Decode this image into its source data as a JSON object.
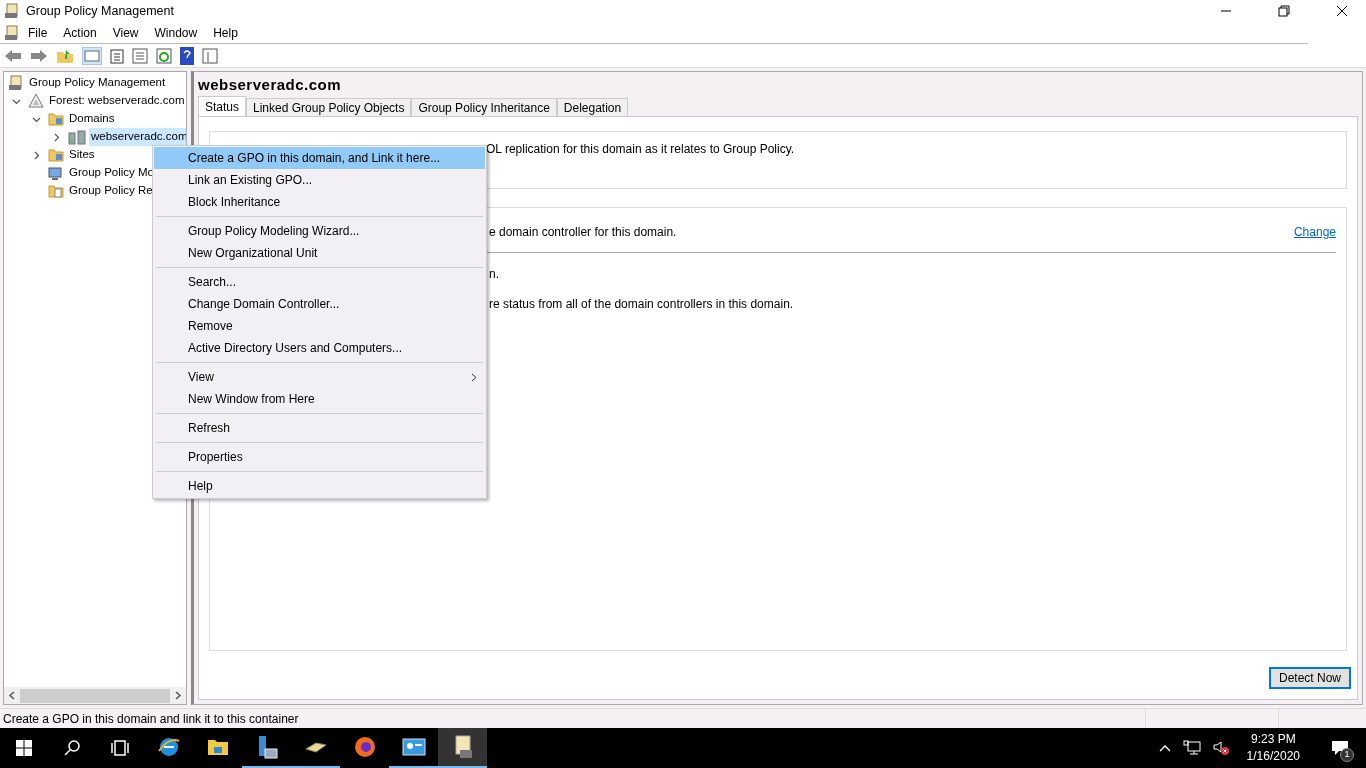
{
  "window": {
    "title": "Group Policy Management"
  },
  "menu_bar": [
    "File",
    "Action",
    "View",
    "Window",
    "Help"
  ],
  "tree": [
    {
      "label": "Group Policy Management",
      "kind": "console",
      "selected": false,
      "children": [
        {
          "label": "Forest: webserveradc.com",
          "kind": "forest",
          "expanded": true,
          "selected": false,
          "children": [
            {
              "label": "Domains",
              "kind": "folder",
              "expanded": true,
              "selected": false,
              "children": [
                {
                  "label": "webserveradc.com",
                  "kind": "domain",
                  "expanded": false,
                  "selected": true
                }
              ]
            },
            {
              "label": "Sites",
              "kind": "folder",
              "expanded": false,
              "selected": false
            },
            {
              "label": "Group Policy Mo",
              "kind": "modeling",
              "selected": false
            },
            {
              "label": "Group Policy Re",
              "kind": "results",
              "selected": false
            }
          ]
        }
      ]
    }
  ],
  "pane": {
    "title": "webserveradc.com",
    "tabs": [
      {
        "label": "Status",
        "selected": true
      },
      {
        "label": "Linked Group Policy Objects",
        "selected": false
      },
      {
        "label": "Group Policy Inheritance",
        "selected": false
      },
      {
        "label": "Delegation",
        "selected": false
      }
    ],
    "section_1": {
      "text": "OL replication for this domain as it relates to Group Policy."
    },
    "section_2": {
      "text": "e domain controller for this domain.",
      "link": "Change",
      "lines": [
        "n.",
        "re status from all of the domain controllers in this domain."
      ]
    },
    "button": "Detect Now"
  },
  "context_menu": [
    {
      "kind": "item",
      "label": "Create a GPO in this domain, and Link it here...",
      "selected": true
    },
    {
      "kind": "item",
      "label": "Link an Existing GPO...",
      "selected": false
    },
    {
      "kind": "item",
      "label": "Block Inheritance",
      "selected": false
    },
    {
      "kind": "separator"
    },
    {
      "kind": "item",
      "label": "Group Policy Modeling Wizard...",
      "selected": false
    },
    {
      "kind": "item",
      "label": "New Organizational Unit",
      "selected": false
    },
    {
      "kind": "separator"
    },
    {
      "kind": "item",
      "label": "Search...",
      "selected": false
    },
    {
      "kind": "item",
      "label": "Change Domain Controller...",
      "selected": false
    },
    {
      "kind": "item",
      "label": "Remove",
      "selected": false
    },
    {
      "kind": "item",
      "label": "Active Directory Users and Computers...",
      "selected": false
    },
    {
      "kind": "separator"
    },
    {
      "kind": "submenu",
      "label": "View",
      "selected": false
    },
    {
      "kind": "item",
      "label": "New Window from Here",
      "selected": false
    },
    {
      "kind": "separator"
    },
    {
      "kind": "item",
      "label": "Refresh",
      "selected": false
    },
    {
      "kind": "separator"
    },
    {
      "kind": "item",
      "label": "Properties",
      "selected": false
    },
    {
      "kind": "separator"
    },
    {
      "kind": "item",
      "label": "Help",
      "selected": false
    }
  ],
  "status_bar": "Create a GPO in this domain and link it to this container",
  "taskbar": {
    "apps": [
      {
        "kind": "ie",
        "running": false,
        "active": false
      },
      {
        "kind": "explorer",
        "running": false,
        "active": false
      },
      {
        "kind": "server",
        "running": true,
        "active": false
      },
      {
        "kind": "drive",
        "running": true,
        "active": false
      },
      {
        "kind": "firefox",
        "running": false,
        "active": false
      },
      {
        "kind": "control",
        "running": true,
        "active": false
      },
      {
        "kind": "gpm",
        "running": true,
        "active": true
      }
    ],
    "time": "9:23 PM",
    "date": "1/16/2020",
    "notifications": "1"
  }
}
